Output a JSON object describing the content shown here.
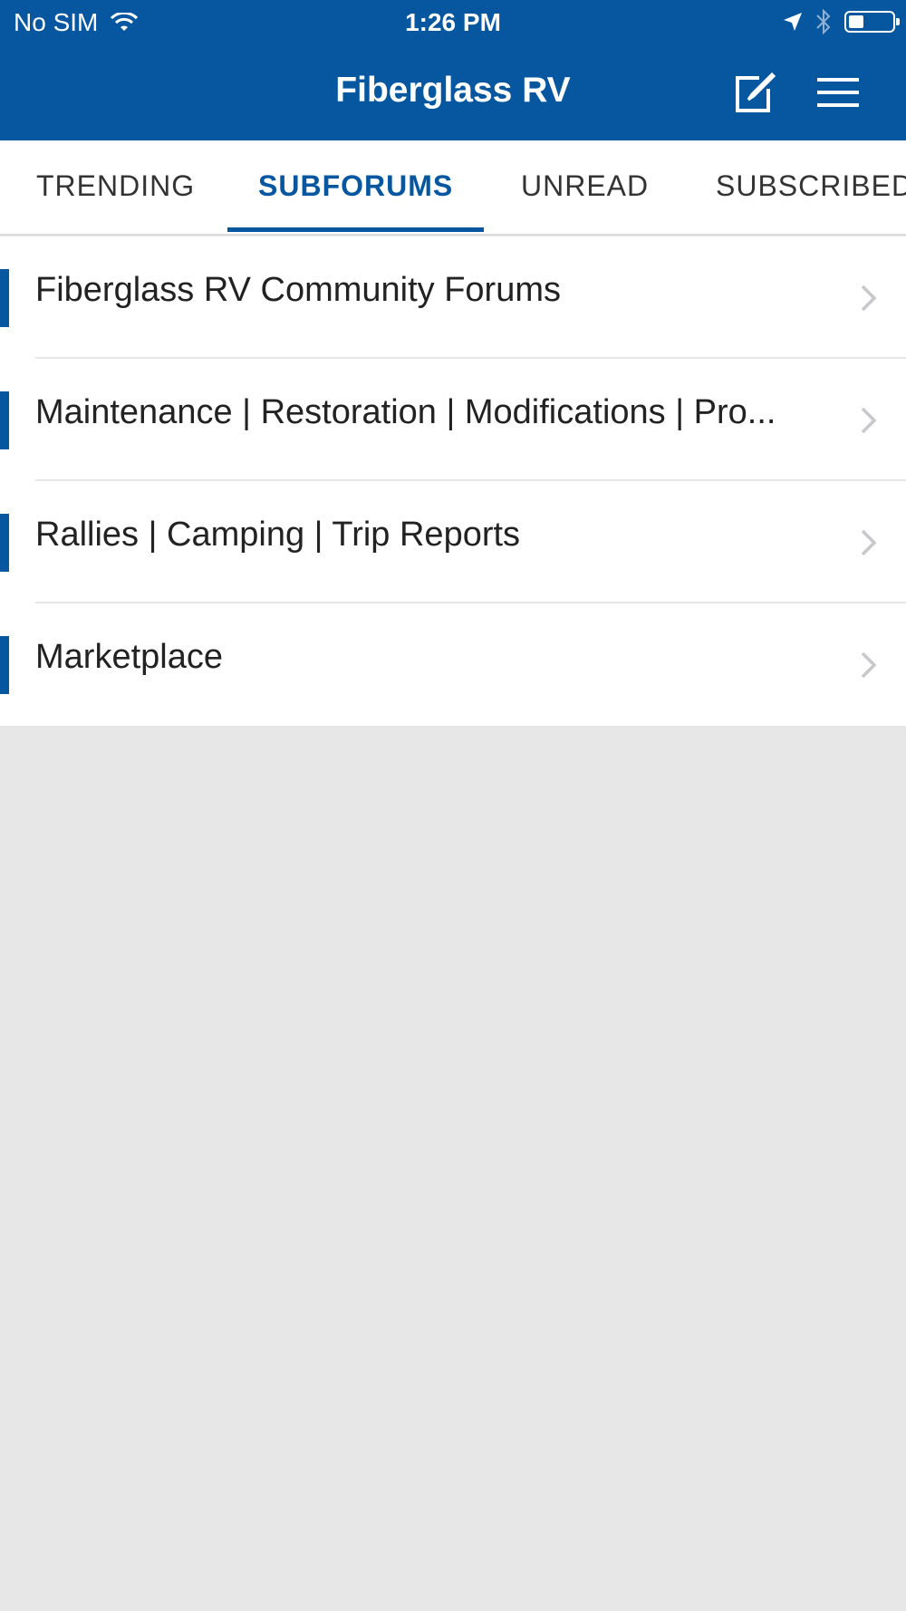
{
  "status_bar": {
    "carrier": "No SIM",
    "time": "1:26 PM",
    "battery_level": 0.35,
    "icons": [
      "wifi-icon",
      "location-arrow-icon",
      "bluetooth-icon",
      "battery-icon"
    ]
  },
  "header": {
    "title": "Fiberglass RV",
    "background_color": "#0657a0",
    "actions": [
      "compose-icon",
      "hamburger-menu-icon"
    ]
  },
  "tabs": [
    {
      "label": "TRENDING",
      "active": false
    },
    {
      "label": "SUBFORUMS",
      "active": true
    },
    {
      "label": "UNREAD",
      "active": false
    },
    {
      "label": "SUBSCRIBED",
      "active": false
    }
  ],
  "subforums": [
    {
      "label": "Fiberglass RV Community Forums"
    },
    {
      "label": "Maintenance | Restoration | Modifications | Pro..."
    },
    {
      "label": "Rallies | Camping | Trip Reports"
    },
    {
      "label": "Marketplace"
    }
  ],
  "colors": {
    "accent": "#0657a0",
    "background": "#e7e7e7",
    "list_background": "#ffffff"
  }
}
